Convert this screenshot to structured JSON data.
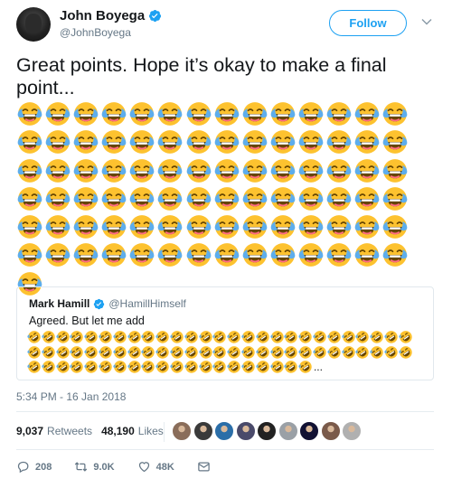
{
  "author": {
    "display_name": "John Boyega",
    "handle": "@JohnBoyega"
  },
  "follow_label": "Follow",
  "tweet_text": "Great points. Hope it’s okay to make a final point...",
  "emoji_name": "face-with-tears-of-joy",
  "emoji_count": 85,
  "quoted_tweet": {
    "display_name": "Mark Hamill",
    "handle": "@HamillHimself",
    "text": "Agreed. But let me add",
    "emoji_name": "rolling-on-the-floor-laughing",
    "emoji_count": 74,
    "ellipsis": "..."
  },
  "timestamp": "5:34 PM - 16 Jan 2018",
  "stats": {
    "retweets_count": "9,037",
    "retweets_label": "Retweets",
    "likes_count": "48,190",
    "likes_label": "Likes"
  },
  "liker_avatar_colors": [
    "#8a6d5a",
    "#3a3a3a",
    "#2b6ea8",
    "#4a4a6a",
    "#222222",
    "#9aa0a6",
    "#111133",
    "#7a5a4a",
    "#b0b0b0"
  ],
  "actions": {
    "replies": "208",
    "retweets": "9.0K",
    "likes": "48K"
  },
  "colors": {
    "accent": "#1da1f2",
    "muted": "#657786",
    "emoji_yellow": "#fdc22f"
  }
}
